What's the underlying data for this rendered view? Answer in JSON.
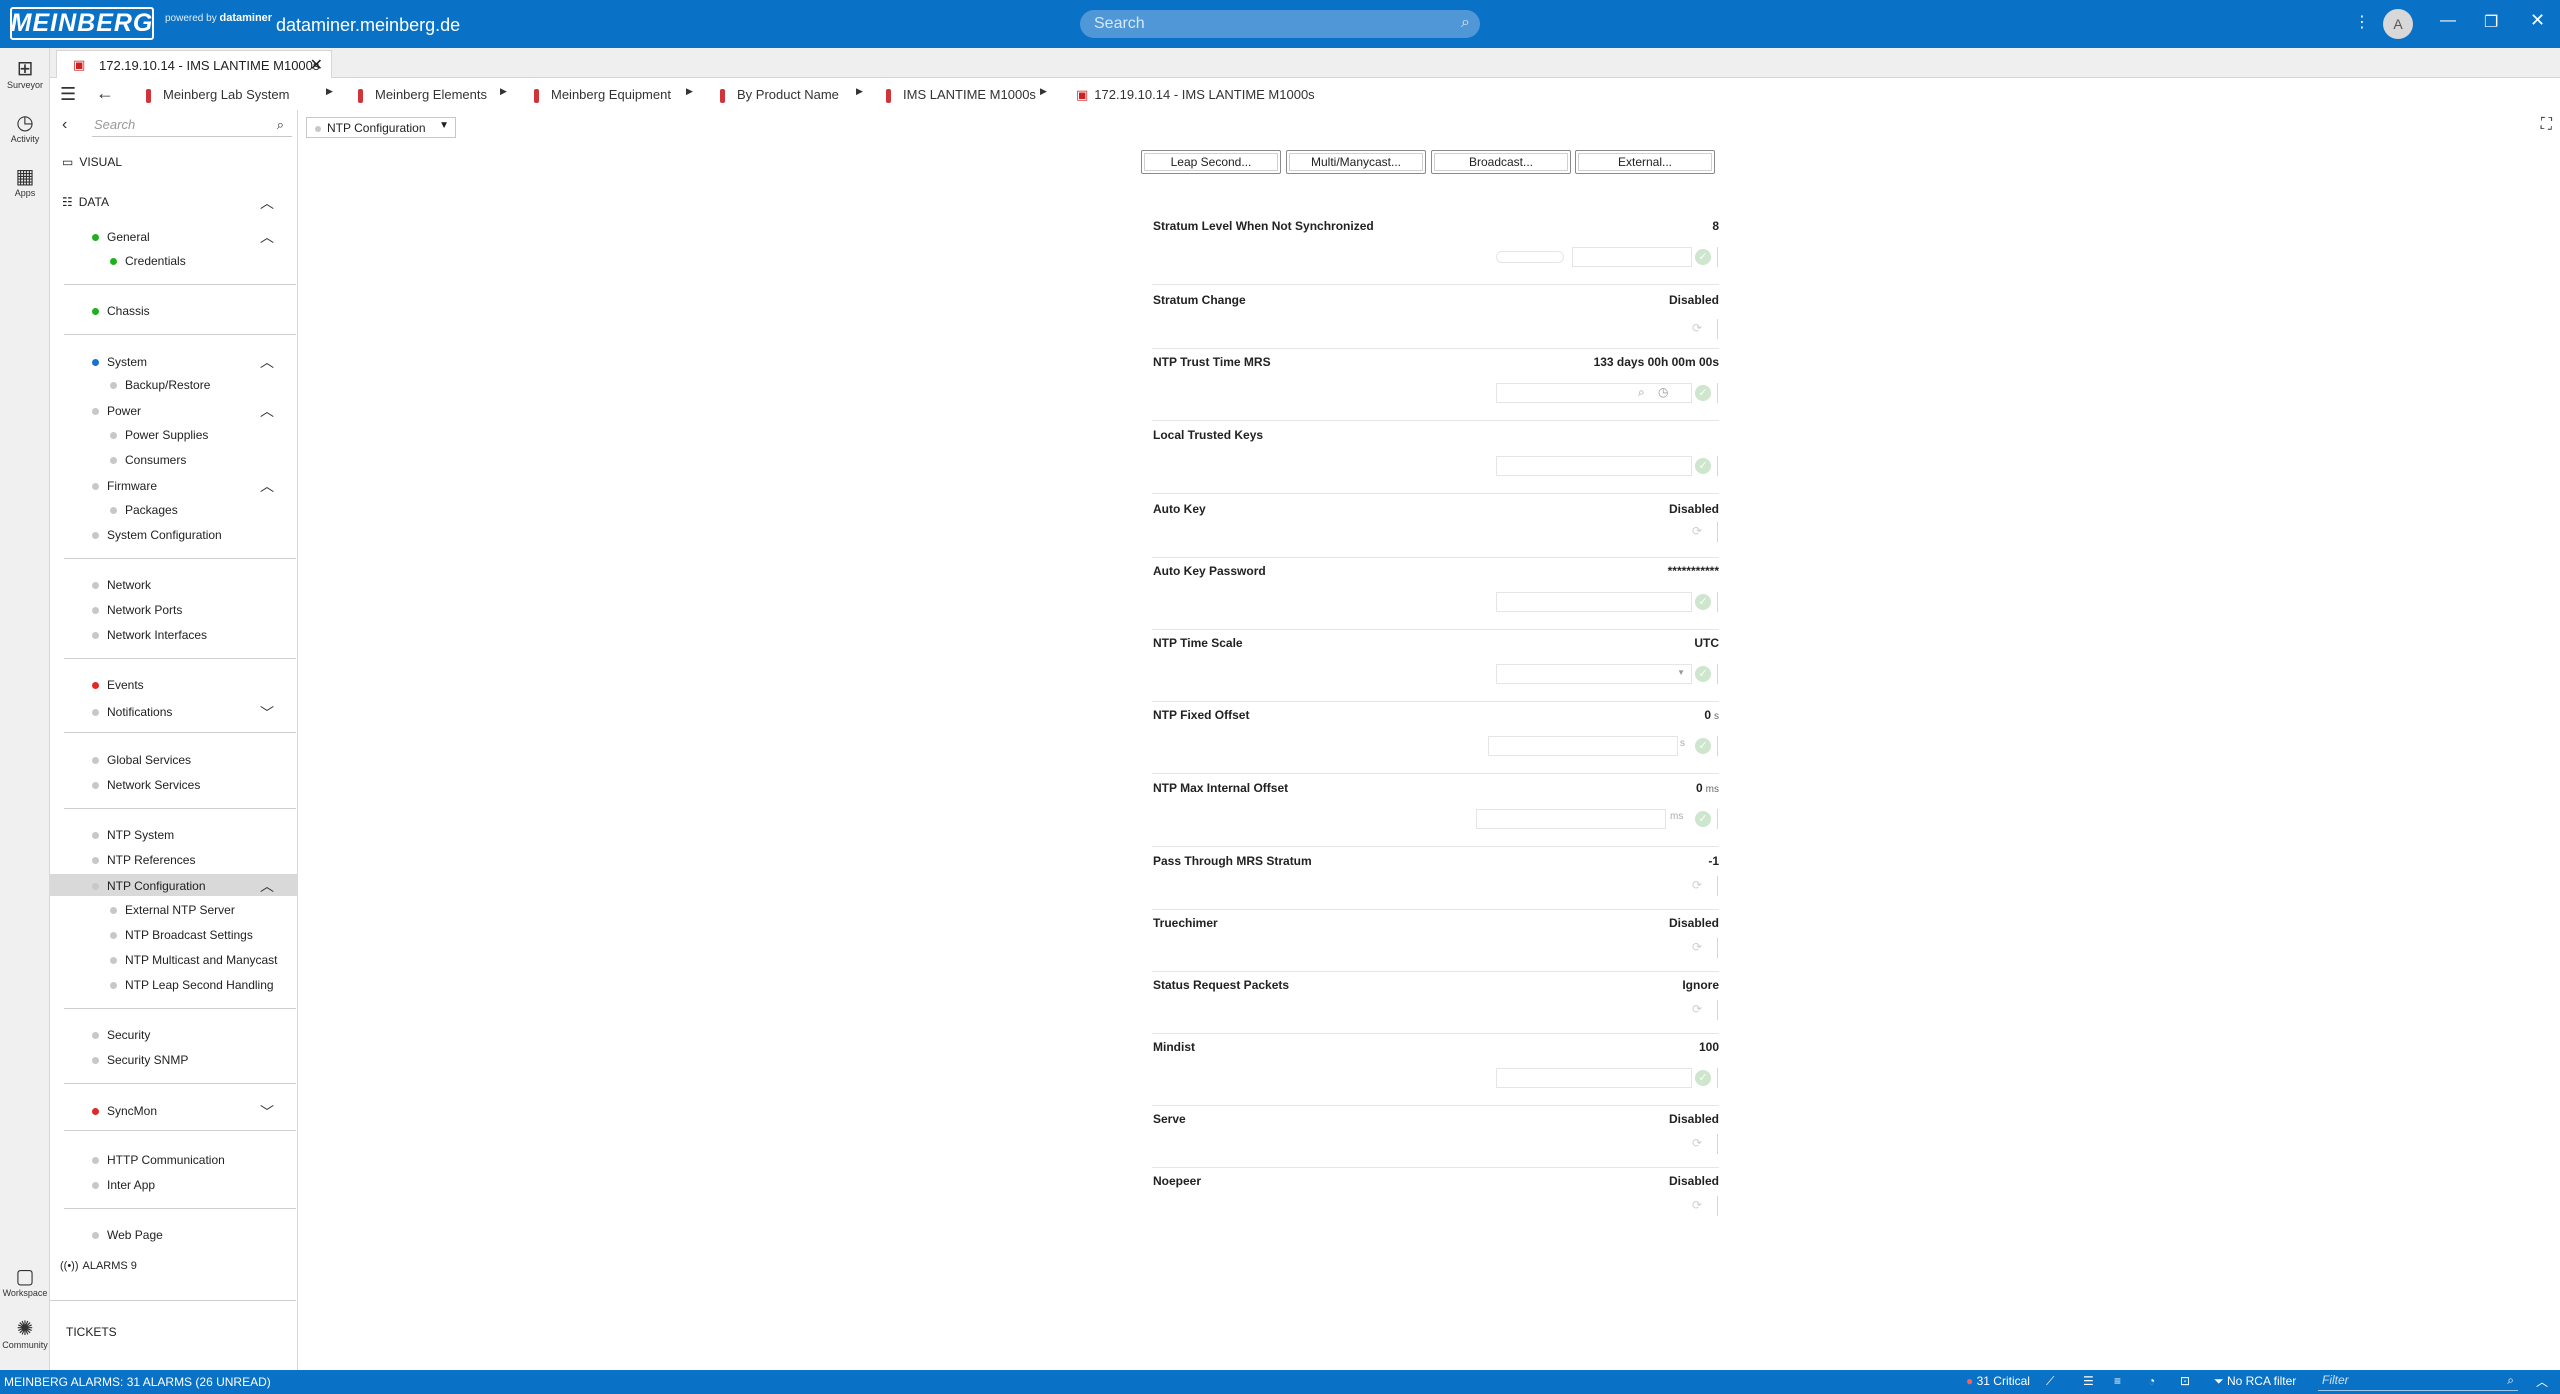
{
  "header": {
    "logo": "MEINBERG",
    "powered_by": "powered by",
    "powered_brand": "dataminer",
    "hostname": "dataminer.meinberg.de",
    "search_placeholder": "Search",
    "avatar_initial": "A"
  },
  "rail": [
    {
      "label": "Surveyor",
      "icon": "surveyor-icon"
    },
    {
      "label": "Activity",
      "icon": "history-icon"
    },
    {
      "label": "Apps",
      "icon": "apps-icon"
    },
    {
      "label": "Workspace",
      "icon": "workspace-icon"
    },
    {
      "label": "Community",
      "icon": "community-icon"
    }
  ],
  "tab": {
    "label": "172.19.10.14 - IMS LANTIME M1000s"
  },
  "breadcrumb": [
    "Meinberg Lab System",
    "Meinberg Elements",
    "Meinberg Equipment",
    "By Product Name",
    "IMS LANTIME M1000s",
    "172.19.10.14 - IMS LANTIME M1000s"
  ],
  "sidebar": {
    "search_placeholder": "Search",
    "visual": "VISUAL",
    "data": "DATA",
    "items": {
      "general": "General",
      "credentials": "Credentials",
      "chassis": "Chassis",
      "system": "System",
      "backup_restore": "Backup/Restore",
      "power": "Power",
      "power_supplies": "Power Supplies",
      "consumers": "Consumers",
      "firmware": "Firmware",
      "packages": "Packages",
      "system_configuration": "System Configuration",
      "network": "Network",
      "network_ports": "Network Ports",
      "network_interfaces": "Network Interfaces",
      "events": "Events",
      "notifications": "Notifications",
      "global_services": "Global Services",
      "network_services": "Network Services",
      "ntp_system": "NTP System",
      "ntp_references": "NTP References",
      "ntp_configuration": "NTP Configuration",
      "external_ntp_server": "External NTP Server",
      "ntp_broadcast_settings": "NTP Broadcast Settings",
      "ntp_multicast_manycast": "NTP Multicast and Manycast",
      "ntp_leap_second": "NTP Leap Second Handling",
      "security": "Security",
      "security_snmp": "Security SNMP",
      "syncmon": "SyncMon",
      "http_communication": "HTTP Communication",
      "inter_app": "Inter App",
      "web_page": "Web Page"
    },
    "alarms": "ALARMS 9",
    "tickets": "TICKETS"
  },
  "main": {
    "page_dropdown": "NTP Configuration",
    "buttons": {
      "leap_second": "Leap Second...",
      "multicast": "Multi/Manycast...",
      "broadcast": "Broadcast...",
      "external": "External..."
    },
    "params": {
      "stratum_unsync": {
        "label": "Stratum Level When Not Synchronized",
        "value": "8"
      },
      "stratum_change": {
        "label": "Stratum Change",
        "value": "Disabled"
      },
      "trust_time": {
        "label": "NTP Trust Time MRS",
        "value": "133 days 00h 00m 00s"
      },
      "trusted_keys": {
        "label": "Local Trusted Keys",
        "value": ""
      },
      "auto_key": {
        "label": "Auto Key",
        "value": "Disabled"
      },
      "auto_key_password": {
        "label": "Auto Key Password",
        "value": "***********"
      },
      "time_scale": {
        "label": "NTP Time Scale",
        "value": "UTC"
      },
      "fixed_offset": {
        "label": "NTP Fixed Offset",
        "value": "0",
        "unit": "s"
      },
      "max_internal_offset": {
        "label": "NTP Max Internal Offset",
        "value": "0",
        "unit": "ms"
      },
      "pass_through": {
        "label": "Pass Through MRS Stratum",
        "value": "-1"
      },
      "truechimer": {
        "label": "Truechimer",
        "value": "Disabled"
      },
      "status_request": {
        "label": "Status Request Packets",
        "value": "Ignore"
      },
      "mindist": {
        "label": "Mindist",
        "value": "100"
      },
      "serve": {
        "label": "Serve",
        "value": "Disabled"
      },
      "noepeer": {
        "label": "Noepeer",
        "value": "Disabled"
      }
    }
  },
  "statusbar": {
    "alarms_text": "MEINBERG ALARMS: 31 ALARMS (26 UNREAD)",
    "critical": "31 Critical",
    "rca": "No RCA filter",
    "filter_placeholder": "Filter"
  },
  "colors": {
    "brand_blue": "#0a72c6",
    "status_green": "#1eb01e",
    "status_red": "#e02828",
    "status_blue": "#1a6fd6"
  }
}
